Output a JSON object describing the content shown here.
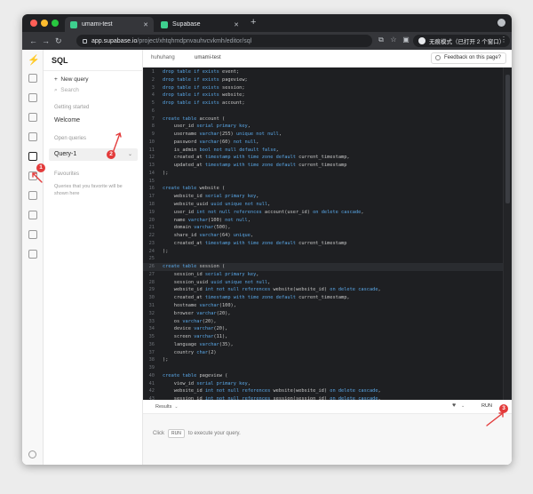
{
  "browser": {
    "tabs": [
      {
        "title": "umami-test",
        "active": true
      },
      {
        "title": "Supabase",
        "active": false
      }
    ],
    "url_host": "app.supabase.io",
    "url_path": "/project/xhtqhmdpnvauhvcvkmh/editor/sql",
    "incognito_label": "无痕模式（已打开 2 个窗口）"
  },
  "sidebar": {
    "title": "SQL",
    "new_query": "New query",
    "search_placeholder": "Search",
    "getting_started_heading": "Getting started",
    "welcome": "Welcome",
    "open_queries_heading": "Open queries",
    "open_query": "Query-1",
    "favourites_heading": "Favourites",
    "favourites_help": "Queries that you favorite will be shown here"
  },
  "header": {
    "org": "huhuhang",
    "project": "umami-test",
    "feedback": "Feedback on this page?"
  },
  "editor": {
    "current_line": 26,
    "lines": [
      "drop table if exists event;",
      "drop table if exists pageview;",
      "drop table if exists session;",
      "drop table if exists website;",
      "drop table if exists account;",
      "",
      "create table account (",
      "    user_id serial primary key,",
      "    username varchar(255) unique not null,",
      "    password varchar(60) not null,",
      "    is_admin bool not null default false,",
      "    created_at timestamp with time zone default current_timestamp,",
      "    updated_at timestamp with time zone default current_timestamp",
      ");",
      "",
      "create table website (",
      "    website_id serial primary key,",
      "    website_uuid uuid unique not null,",
      "    user_id int not null references account(user_id) on delete cascade,",
      "    name varchar(100) not null,",
      "    domain varchar(500),",
      "    share_id varchar(64) unique,",
      "    created_at timestamp with time zone default current_timestamp",
      ");",
      "",
      "create table session (",
      "    session_id serial primary key,",
      "    session_uuid uuid unique not null,",
      "    website_id int not null references website(website_id) on delete cascade,",
      "    created_at timestamp with time zone default current_timestamp,",
      "    hostname varchar(100),",
      "    browser varchar(20),",
      "    os varchar(20),",
      "    device varchar(20),",
      "    screen varchar(11),",
      "    language varchar(35),",
      "    country char(2)",
      ");",
      "",
      "create table pageview (",
      "    view_id serial primary key,",
      "    website_id int not null references website(website_id) on delete cascade,",
      "    session_id int not null references session(session_id) on delete cascade,"
    ]
  },
  "results": {
    "tab_label": "Results",
    "run_label": "RUN",
    "message_before": "Click",
    "message_key": "RUN",
    "message_after": "to execute your query."
  },
  "annotations": {
    "badge_1": "1",
    "badge_2": "2",
    "badge_3": "3",
    "color": "#e33b3b"
  }
}
